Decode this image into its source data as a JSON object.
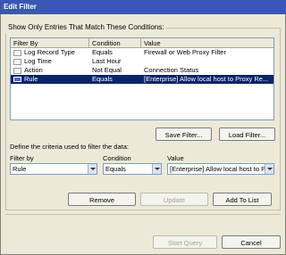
{
  "window": {
    "title": "Edit Filter"
  },
  "group_caption": "Show Only Entries That Match These Conditions:",
  "list": {
    "headers": [
      "Filter By",
      "Condition",
      "Value"
    ],
    "rows": [
      {
        "filter_by": "Log Record Type",
        "condition": "Equals",
        "value": "Firewall or Web Proxy Filter",
        "selected": false
      },
      {
        "filter_by": "Log Time",
        "condition": "Last Hour",
        "value": "",
        "selected": false
      },
      {
        "filter_by": "Action",
        "condition": "Not Equal",
        "value": "Connection Status",
        "selected": false
      },
      {
        "filter_by": "Rule",
        "condition": "Equals",
        "value": "[Enterprise] Allow local host to Proxy Re...",
        "selected": true
      }
    ]
  },
  "buttons": {
    "save_filter": "Save Filter...",
    "load_filter": "Load Filter...",
    "remove": "Remove",
    "update": "Update",
    "add_to_list": "Add To List",
    "start_query": "Start Query",
    "cancel": "Cancel"
  },
  "criteria": {
    "caption": "Define the criteria used to filter the data:",
    "filter_by_label": "Filter by",
    "condition_label": "Condition",
    "value_label": "Value",
    "filter_by_value": "Rule",
    "condition_value": "Equals",
    "value_value": "[Enterprise] Allow local host to P"
  }
}
